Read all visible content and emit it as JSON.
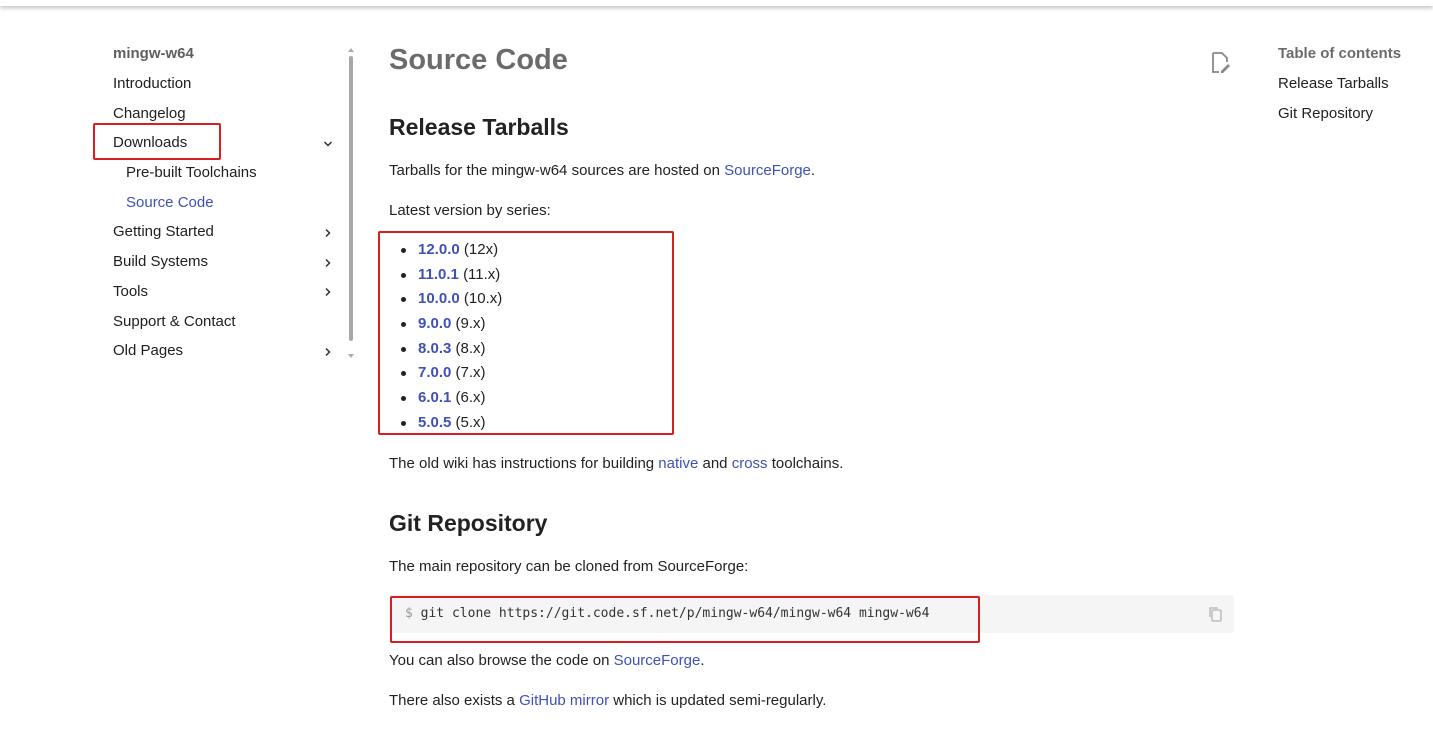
{
  "nav": {
    "title": "mingw-w64",
    "items": [
      {
        "label": "Introduction"
      },
      {
        "label": "Changelog"
      },
      {
        "label": "Downloads"
      },
      {
        "label": "Pre-built Toolchains"
      },
      {
        "label": "Source Code"
      },
      {
        "label": "Getting Started"
      },
      {
        "label": "Build Systems"
      },
      {
        "label": "Tools"
      },
      {
        "label": "Support & Contact"
      },
      {
        "label": "Old Pages"
      }
    ],
    "chevron_down_glyph": "chevron-down-icon",
    "chevron_right_glyph": "chevron-right-icon"
  },
  "page": {
    "title": "Source Code",
    "release": {
      "heading": "Release Tarballs",
      "intro_before": "Tarballs for the mingw-w64 sources are hosted on ",
      "intro_link": "SourceForge",
      "intro_after": ".",
      "latest_label": "Latest version by series:",
      "versions": [
        {
          "version": "12.0.0",
          "series": "(12x)"
        },
        {
          "version": "11.0.1",
          "series": "(11.x)"
        },
        {
          "version": "10.0.0",
          "series": "(10.x)"
        },
        {
          "version": "9.0.0",
          "series": "(9.x)"
        },
        {
          "version": "8.0.3",
          "series": "(8.x)"
        },
        {
          "version": "7.0.0",
          "series": "(7.x)"
        },
        {
          "version": "6.0.1",
          "series": "(6.x)"
        },
        {
          "version": "5.0.5",
          "series": "(5.x)"
        }
      ],
      "wiki_before": "The old wiki has instructions for building ",
      "wiki_link_native": "native",
      "wiki_and": " and ",
      "wiki_link_cross": "cross",
      "wiki_after": " toolchains."
    },
    "git": {
      "heading": "Git Repository",
      "intro": "The main repository can be cloned from SourceForge:",
      "prompt": "$",
      "command": "git clone https://git.code.sf.net/p/mingw-w64/mingw-w64 mingw-w64",
      "browse_before": "You can also browse the code on ",
      "browse_link": "SourceForge",
      "browse_after": ".",
      "mirror_before": "There also exists a ",
      "mirror_link": "GitHub mirror",
      "mirror_after": " which is updated semi-regularly."
    }
  },
  "toc": {
    "title": "Table of contents",
    "items": [
      "Release Tarballs",
      "Git Repository"
    ]
  },
  "colors": {
    "link": "#3f51b5",
    "annotation": "#d61f1f"
  }
}
